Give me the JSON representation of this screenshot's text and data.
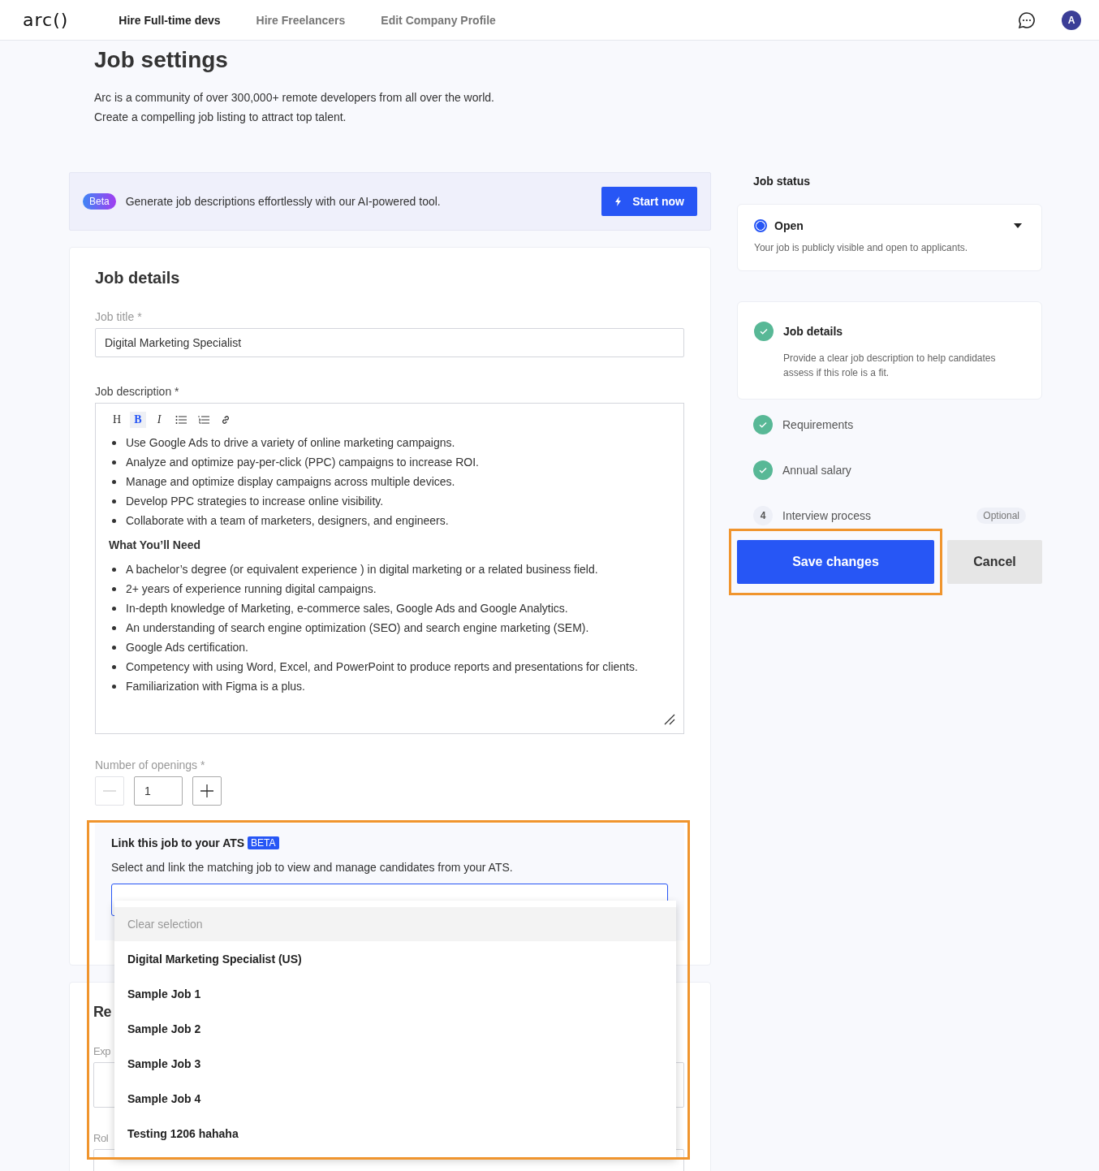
{
  "nav": {
    "logo": "arc()",
    "links": [
      {
        "label": "Hire Full-time devs",
        "selected": true
      },
      {
        "label": "Hire Freelancers",
        "selected": false
      },
      {
        "label": "Edit Company Profile",
        "selected": false
      }
    ],
    "avatar": "A"
  },
  "page": {
    "title": "Job settings",
    "intro": [
      "Arc is a community of over 300,000+ remote developers from all over the world.",
      "Create a compelling job listing to attract top talent."
    ]
  },
  "ai_banner": {
    "badge": "Beta",
    "text": "Generate job descriptions effortlessly with our AI-powered tool.",
    "button": "Start now"
  },
  "job_details": {
    "title": "Job details",
    "job_title": {
      "label": "Job title *",
      "value": "Digital Marketing Specialist"
    },
    "description": {
      "label": "Job description *",
      "toolbar": [
        {
          "kind": "heading",
          "glyph": "H",
          "selected": false
        },
        {
          "kind": "bold",
          "glyph": "B",
          "selected": true
        },
        {
          "kind": "italic",
          "glyph": "I",
          "selected": false
        },
        {
          "kind": "bullet-list",
          "selected": false
        },
        {
          "kind": "numbered-list",
          "selected": false
        },
        {
          "kind": "link",
          "selected": false
        }
      ],
      "blocks": [
        {
          "kind": "list",
          "items": [
            "Use Google Ads to drive a variety of online marketing campaigns.",
            "Analyze and optimize pay-per-click (PPC) campaigns to increase ROI.",
            "Manage and optimize display campaigns across multiple devices.",
            "Develop PPC strategies to increase online visibility.",
            "Collaborate with a team of marketers, designers, and engineers."
          ]
        },
        {
          "kind": "heading",
          "text": "What You’ll Need"
        },
        {
          "kind": "list",
          "items": [
            "A bachelor’s degree (or equivalent experience ) in digital marketing or a related business field.",
            "2+ years of experience running digital campaigns.",
            "In-depth knowledge of Marketing, e-commerce sales, Google Ads and Google Analytics.",
            "An understanding of search engine optimization (SEO) and search engine marketing (SEM).",
            "Google Ads certification.",
            "Competency with using Word, Excel, and PowerPoint to produce reports and presentations for clients.",
            "Familiarization with Figma is a plus."
          ]
        }
      ]
    },
    "openings": {
      "label": "Number of openings *",
      "value": "1",
      "decrement_disabled": true
    },
    "ats": {
      "title": "Link this job to your ATS",
      "badge": "BETA",
      "text": "Select and link the matching job to view and manage candidates from your ATS.",
      "dropdown": {
        "clear": "Clear selection",
        "options": [
          "Digital Marketing Specialist (US)",
          "Sample Job 1",
          "Sample Job 2",
          "Sample Job 3",
          "Sample Job 4",
          "Testing 1206 hahaha"
        ]
      }
    }
  },
  "requirements_card": {
    "title": "Re",
    "field_1_label": "Exp",
    "field_2_label": "Rol"
  },
  "job_status": {
    "heading": "Job status",
    "status": "Open",
    "description": "Your job is publicly visible and open to applicants."
  },
  "steps": [
    {
      "title": "Job details",
      "description": "Provide a clear job description to help candidates assess if this role is a fit.",
      "done": true,
      "expanded": true
    },
    {
      "title": "Requirements",
      "done": true,
      "expanded": false
    },
    {
      "title": "Annual salary",
      "done": true,
      "expanded": false
    },
    {
      "title": "Interview process",
      "number": "4",
      "tag": "Optional",
      "done": false,
      "expanded": false
    }
  ],
  "actions": {
    "save": "Save changes",
    "cancel": "Cancel"
  }
}
